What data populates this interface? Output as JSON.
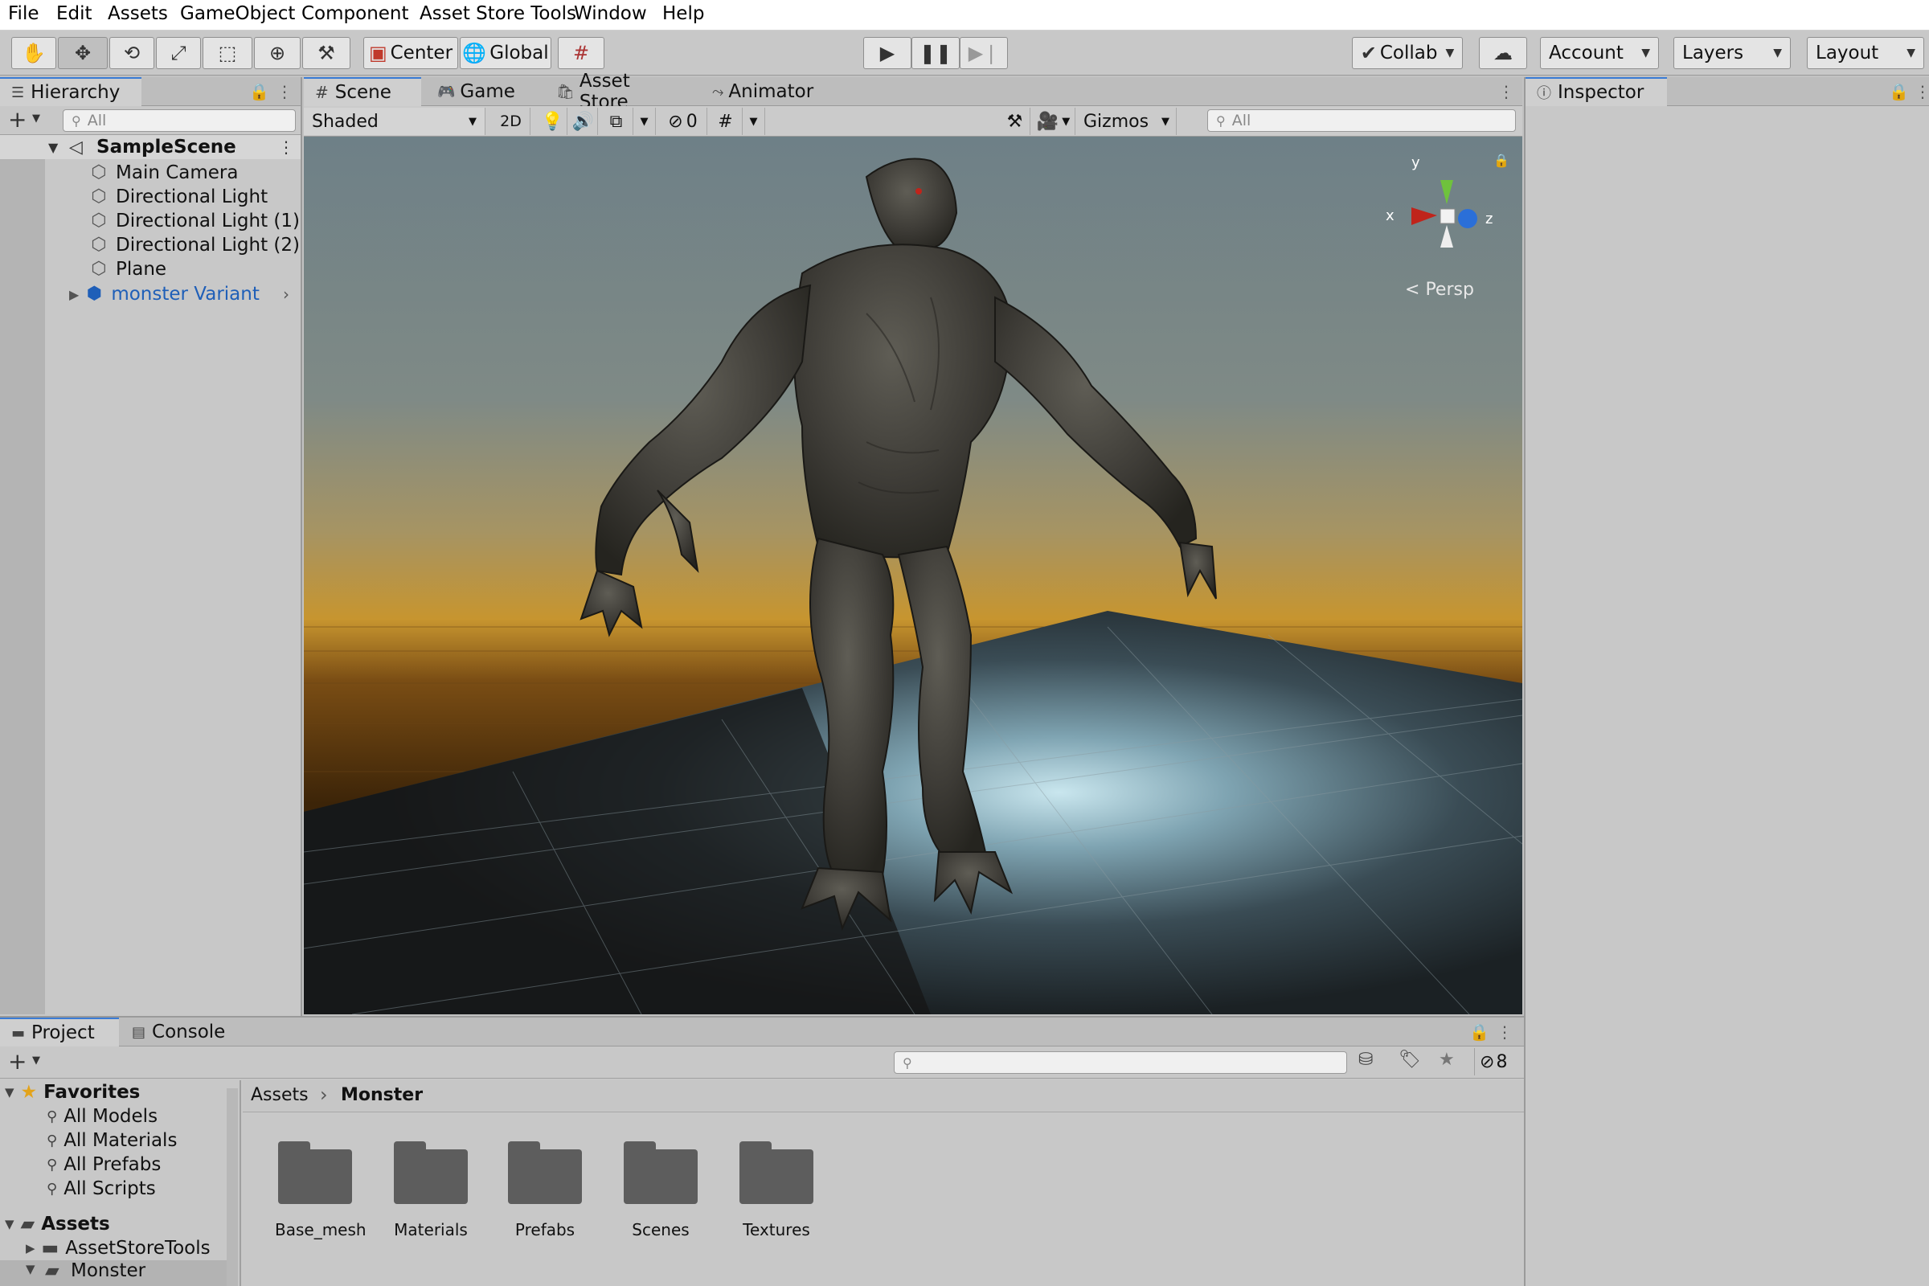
{
  "menu": [
    "File",
    "Edit",
    "Assets",
    "GameObject",
    "Component",
    "Asset Store Tools",
    "Window",
    "Help"
  ],
  "toolbar": {
    "pivot_label": "Center",
    "space_label": "Global",
    "collab_label": "Collab",
    "account_label": "Account",
    "layers_label": "Layers",
    "layout_label": "Layout"
  },
  "hierarchy": {
    "tab_label": "Hierarchy",
    "search_placeholder": "All",
    "scene_name": "SampleScene",
    "items": [
      "Main Camera",
      "Directional Light",
      "Directional Light (1)",
      "Directional Light (2)",
      "Plane"
    ],
    "prefab_item": "monster Variant"
  },
  "scene": {
    "tabs": [
      "Scene",
      "Game",
      "Asset Store",
      "Animator"
    ],
    "draw_mode": "Shaded",
    "mode_2d": "2D",
    "hidden_count": "0",
    "gizmos_label": "Gizmos",
    "search_placeholder": "All",
    "gizmo_axes": {
      "x": "x",
      "y": "y",
      "z": "z"
    },
    "projection": "Persp"
  },
  "inspector": {
    "tab_label": "Inspector"
  },
  "project": {
    "tabs": [
      "Project",
      "Console"
    ],
    "hidden_count": "8",
    "favorites_label": "Favorites",
    "favorites": [
      "All Models",
      "All Materials",
      "All Prefabs",
      "All Scripts"
    ],
    "assets_label": "Assets",
    "asset_tree": [
      "AssetStoreTools",
      "Monster"
    ],
    "breadcrumb": [
      "Assets",
      "Monster"
    ],
    "folders": [
      "Base_mesh",
      "Materials",
      "Prefabs",
      "Scenes",
      "Textures"
    ]
  },
  "colors": {
    "selection_blue": "#3a7bd5",
    "prefab_blue": "#1f5fb8",
    "panel_bg": "#c8c8c8",
    "folder_gray": "#5d5d5d"
  }
}
